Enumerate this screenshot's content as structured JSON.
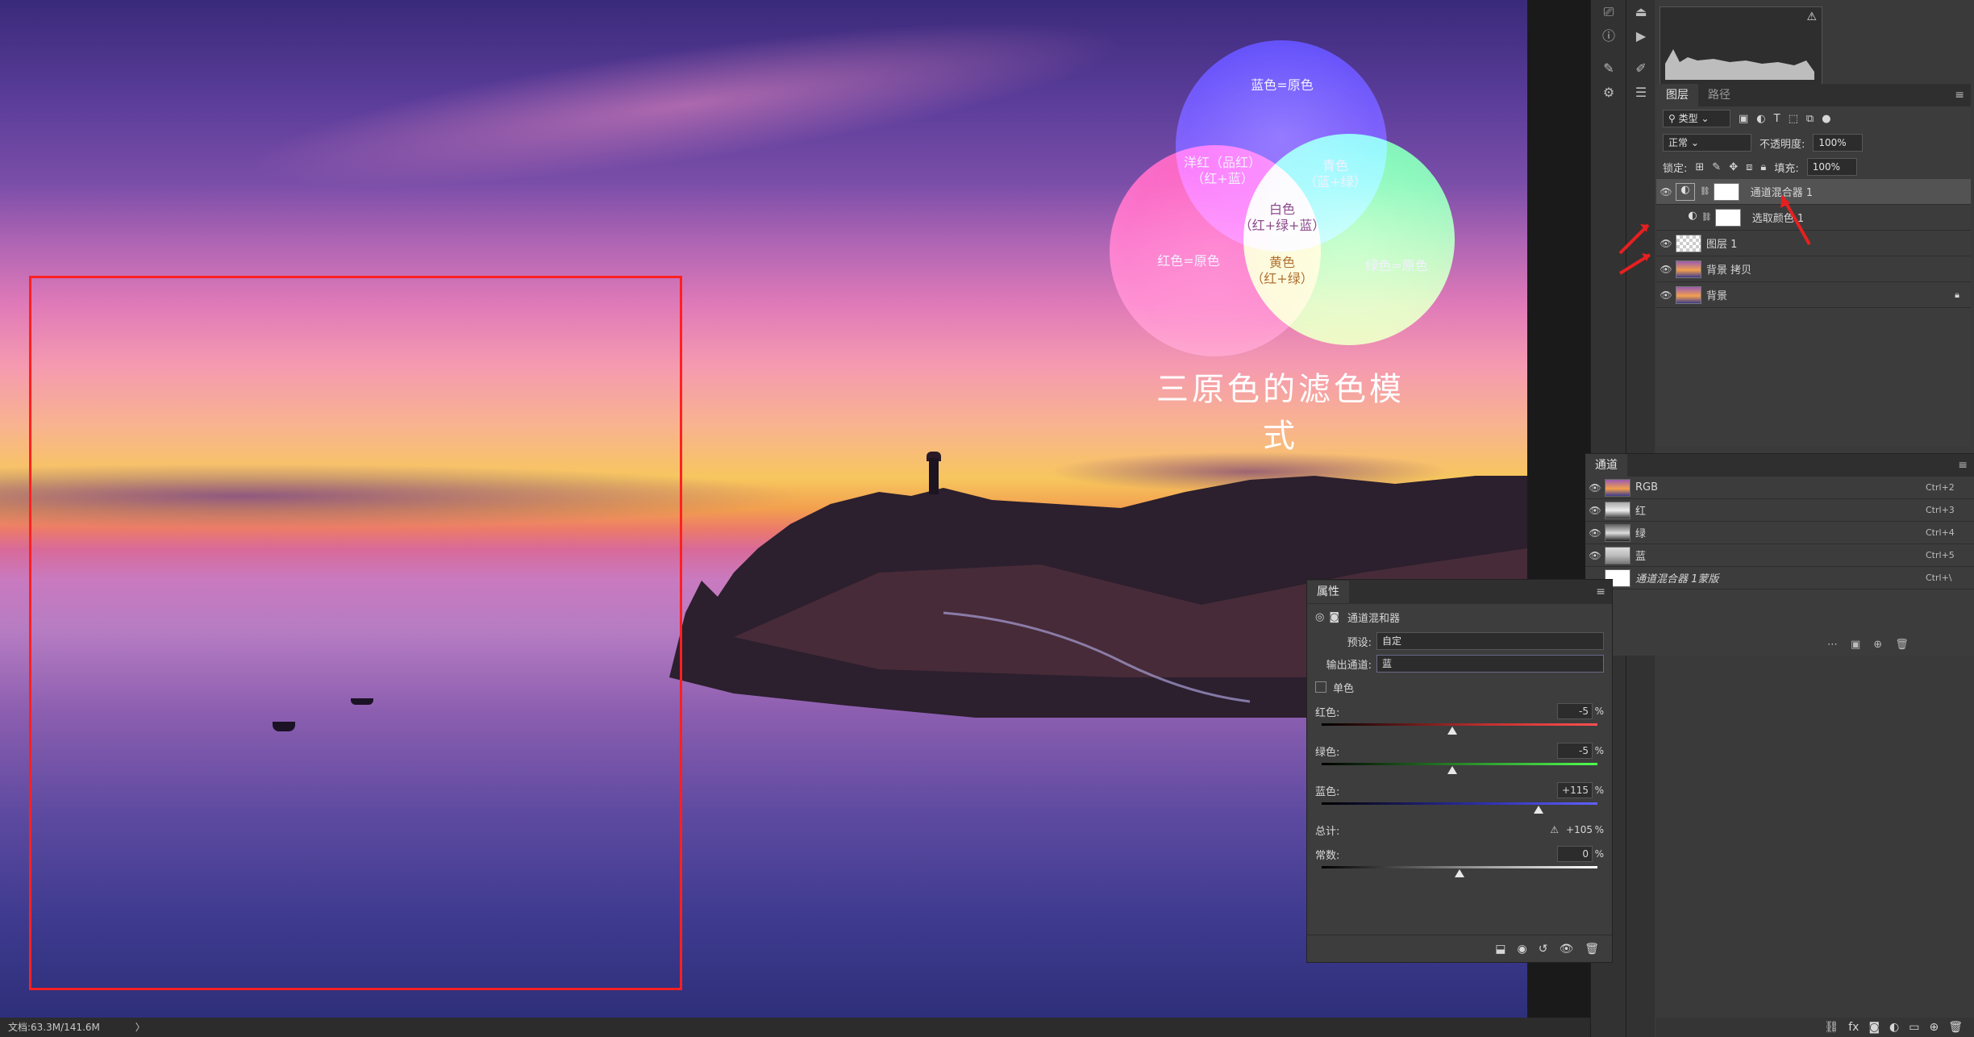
{
  "venn": {
    "blue_label": "蓝色=原色",
    "magenta_label_1": "洋红（品红）",
    "magenta_label_2": "（红+蓝）",
    "cyan_label_1": "青色",
    "cyan_label_2": "（蓝+绿）",
    "white_label_1": "白色",
    "white_label_2": "（红+绿+蓝）",
    "red_label": "红色=原色",
    "green_label": "绿色=原色",
    "yellow_label_1": "黄色",
    "yellow_label_2": "（红+绿）",
    "title": "三原色的滤色模式"
  },
  "layers_panel": {
    "tabs": [
      "图层",
      "路径"
    ],
    "filter_kind": "类型",
    "blend_mode": "正常",
    "opacity_label": "不透明度:",
    "opacity_value": "100%",
    "lock_label": "锁定:",
    "fill_label": "填充:",
    "fill_value": "100%",
    "layers": [
      {
        "name": "通道混合器 1",
        "type": "adjustment",
        "visible": true,
        "selected": true
      },
      {
        "name": "选取颜色 1",
        "type": "adjustment",
        "visible": false,
        "selected": false
      },
      {
        "name": "图层 1",
        "type": "pixel",
        "visible": true,
        "selected": false
      },
      {
        "name": "背景 拷贝",
        "type": "pixel",
        "visible": true,
        "selected": false
      },
      {
        "name": "背景",
        "type": "pixel",
        "visible": true,
        "selected": false,
        "locked": true
      }
    ]
  },
  "channels_panel": {
    "title": "通道",
    "channels": [
      {
        "name": "RGB",
        "shortcut": "Ctrl+2"
      },
      {
        "name": "红",
        "shortcut": "Ctrl+3"
      },
      {
        "name": "绿",
        "shortcut": "Ctrl+4"
      },
      {
        "name": "蓝",
        "shortcut": "Ctrl+5"
      },
      {
        "name": "通道混合器 1蒙版",
        "shortcut": "Ctrl+\\"
      }
    ]
  },
  "properties": {
    "tab": "属性",
    "title": "通道混和器",
    "preset_label": "预设:",
    "preset_value": "自定",
    "output_label": "输出通道:",
    "output_value": "蓝",
    "mono_label": "单色",
    "red_label": "红色:",
    "red_value": "-5",
    "red_pct": 47.5,
    "green_label": "绿色:",
    "green_value": "-5",
    "green_pct": 47.5,
    "blue_label": "蓝色:",
    "blue_value": "+115",
    "blue_pct": 78.75,
    "total_label": "总计:",
    "total_value": "+105",
    "constant_label": "常数:",
    "constant_value": "0",
    "constant_pct": 50,
    "pct_sign": "%"
  },
  "status": {
    "doc_info": "文档:63.3M/141.6M"
  },
  "colors": {
    "accent_red": "#ff2020",
    "panel_bg": "#3c3c3c"
  }
}
